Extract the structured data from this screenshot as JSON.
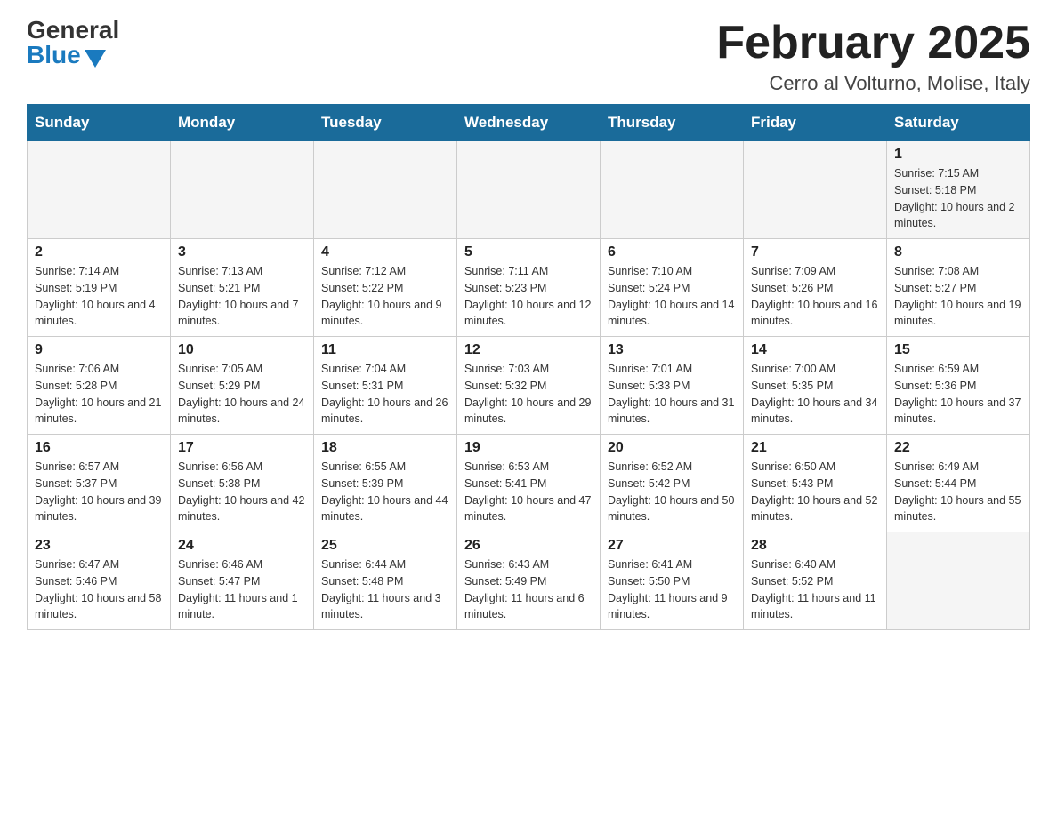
{
  "logo": {
    "general": "General",
    "blue": "Blue"
  },
  "title": "February 2025",
  "location": "Cerro al Volturno, Molise, Italy",
  "days_of_week": [
    "Sunday",
    "Monday",
    "Tuesday",
    "Wednesday",
    "Thursday",
    "Friday",
    "Saturday"
  ],
  "weeks": [
    {
      "days": [
        {
          "number": "",
          "info": ""
        },
        {
          "number": "",
          "info": ""
        },
        {
          "number": "",
          "info": ""
        },
        {
          "number": "",
          "info": ""
        },
        {
          "number": "",
          "info": ""
        },
        {
          "number": "",
          "info": ""
        },
        {
          "number": "1",
          "info": "Sunrise: 7:15 AM\nSunset: 5:18 PM\nDaylight: 10 hours and 2 minutes."
        }
      ]
    },
    {
      "days": [
        {
          "number": "2",
          "info": "Sunrise: 7:14 AM\nSunset: 5:19 PM\nDaylight: 10 hours and 4 minutes."
        },
        {
          "number": "3",
          "info": "Sunrise: 7:13 AM\nSunset: 5:21 PM\nDaylight: 10 hours and 7 minutes."
        },
        {
          "number": "4",
          "info": "Sunrise: 7:12 AM\nSunset: 5:22 PM\nDaylight: 10 hours and 9 minutes."
        },
        {
          "number": "5",
          "info": "Sunrise: 7:11 AM\nSunset: 5:23 PM\nDaylight: 10 hours and 12 minutes."
        },
        {
          "number": "6",
          "info": "Sunrise: 7:10 AM\nSunset: 5:24 PM\nDaylight: 10 hours and 14 minutes."
        },
        {
          "number": "7",
          "info": "Sunrise: 7:09 AM\nSunset: 5:26 PM\nDaylight: 10 hours and 16 minutes."
        },
        {
          "number": "8",
          "info": "Sunrise: 7:08 AM\nSunset: 5:27 PM\nDaylight: 10 hours and 19 minutes."
        }
      ]
    },
    {
      "days": [
        {
          "number": "9",
          "info": "Sunrise: 7:06 AM\nSunset: 5:28 PM\nDaylight: 10 hours and 21 minutes."
        },
        {
          "number": "10",
          "info": "Sunrise: 7:05 AM\nSunset: 5:29 PM\nDaylight: 10 hours and 24 minutes."
        },
        {
          "number": "11",
          "info": "Sunrise: 7:04 AM\nSunset: 5:31 PM\nDaylight: 10 hours and 26 minutes."
        },
        {
          "number": "12",
          "info": "Sunrise: 7:03 AM\nSunset: 5:32 PM\nDaylight: 10 hours and 29 minutes."
        },
        {
          "number": "13",
          "info": "Sunrise: 7:01 AM\nSunset: 5:33 PM\nDaylight: 10 hours and 31 minutes."
        },
        {
          "number": "14",
          "info": "Sunrise: 7:00 AM\nSunset: 5:35 PM\nDaylight: 10 hours and 34 minutes."
        },
        {
          "number": "15",
          "info": "Sunrise: 6:59 AM\nSunset: 5:36 PM\nDaylight: 10 hours and 37 minutes."
        }
      ]
    },
    {
      "days": [
        {
          "number": "16",
          "info": "Sunrise: 6:57 AM\nSunset: 5:37 PM\nDaylight: 10 hours and 39 minutes."
        },
        {
          "number": "17",
          "info": "Sunrise: 6:56 AM\nSunset: 5:38 PM\nDaylight: 10 hours and 42 minutes."
        },
        {
          "number": "18",
          "info": "Sunrise: 6:55 AM\nSunset: 5:39 PM\nDaylight: 10 hours and 44 minutes."
        },
        {
          "number": "19",
          "info": "Sunrise: 6:53 AM\nSunset: 5:41 PM\nDaylight: 10 hours and 47 minutes."
        },
        {
          "number": "20",
          "info": "Sunrise: 6:52 AM\nSunset: 5:42 PM\nDaylight: 10 hours and 50 minutes."
        },
        {
          "number": "21",
          "info": "Sunrise: 6:50 AM\nSunset: 5:43 PM\nDaylight: 10 hours and 52 minutes."
        },
        {
          "number": "22",
          "info": "Sunrise: 6:49 AM\nSunset: 5:44 PM\nDaylight: 10 hours and 55 minutes."
        }
      ]
    },
    {
      "days": [
        {
          "number": "23",
          "info": "Sunrise: 6:47 AM\nSunset: 5:46 PM\nDaylight: 10 hours and 58 minutes."
        },
        {
          "number": "24",
          "info": "Sunrise: 6:46 AM\nSunset: 5:47 PM\nDaylight: 11 hours and 1 minute."
        },
        {
          "number": "25",
          "info": "Sunrise: 6:44 AM\nSunset: 5:48 PM\nDaylight: 11 hours and 3 minutes."
        },
        {
          "number": "26",
          "info": "Sunrise: 6:43 AM\nSunset: 5:49 PM\nDaylight: 11 hours and 6 minutes."
        },
        {
          "number": "27",
          "info": "Sunrise: 6:41 AM\nSunset: 5:50 PM\nDaylight: 11 hours and 9 minutes."
        },
        {
          "number": "28",
          "info": "Sunrise: 6:40 AM\nSunset: 5:52 PM\nDaylight: 11 hours and 11 minutes."
        },
        {
          "number": "",
          "info": ""
        }
      ]
    }
  ]
}
